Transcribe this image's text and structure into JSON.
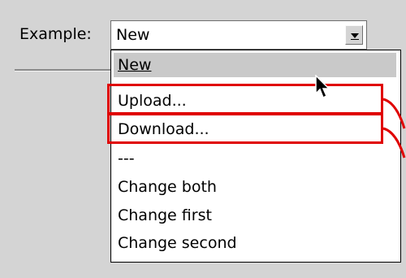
{
  "form": {
    "label": "Example:",
    "selected_value": "New"
  },
  "dropdown": {
    "items": [
      {
        "label": "New",
        "selected": true
      },
      {
        "label": "Upload..."
      },
      {
        "label": "Download..."
      },
      {
        "label": "---"
      },
      {
        "label": "Change both"
      },
      {
        "label": "Change first"
      },
      {
        "label": "Change second"
      }
    ]
  },
  "colors": {
    "annotation": "#e00000",
    "selected_bg": "#c9c9c9",
    "panel_bg": "#d4d4d4"
  },
  "icons": {
    "combo_arrow": "arrow-down-icon",
    "pointer": "mouse-cursor-icon"
  }
}
